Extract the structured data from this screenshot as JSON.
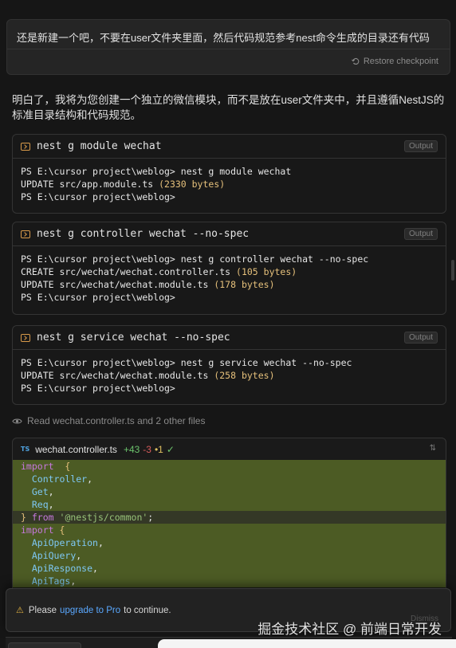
{
  "user_message": {
    "text": "还是新建一个吧，不要在user文件夹里面，然后代码规范参考nest命令生成的目录还有代码",
    "restore_label": "Restore checkpoint"
  },
  "assistant_text": "明白了，我将为您创建一个独立的微信模块，而不是放在user文件夹中，并且遵循NestJS的标准目录结构和代码规范。",
  "terminals": [
    {
      "command": "nest g module wechat",
      "badge": "Output",
      "lines": [
        [
          "PS E:\\cursor project\\weblog> nest g module wechat",
          "",
          ""
        ],
        [
          "UPDATE src/app.module.ts ",
          "(2330 bytes)",
          ""
        ],
        [
          "PS E:\\cursor project\\weblog>",
          "",
          ""
        ]
      ]
    },
    {
      "command": "nest g controller wechat --no-spec",
      "badge": "Output",
      "lines": [
        [
          "PS E:\\cursor project\\weblog> nest g controller wechat --no-spec",
          "",
          ""
        ],
        [
          "CREATE src/wechat/wechat.controller.ts ",
          "(105 bytes)",
          ""
        ],
        [
          "UPDATE src/wechat/wechat.module.ts ",
          "(178 bytes)",
          ""
        ],
        [
          "PS E:\\cursor project\\weblog>",
          "",
          ""
        ]
      ]
    },
    {
      "command": "nest g service wechat --no-spec",
      "badge": "Output",
      "lines": [
        [
          "PS E:\\cursor project\\weblog> nest g service wechat --no-spec",
          "",
          ""
        ],
        [
          "UPDATE src/wechat/wechat.module.ts ",
          "(258 bytes)",
          ""
        ],
        [
          "PS E:\\cursor project\\weblog>",
          "",
          ""
        ]
      ]
    }
  ],
  "read_line": "Read wechat.controller.ts and 2 other files",
  "code_file": {
    "lang_badge": "TS",
    "filename": "wechat.controller.ts",
    "added": "+43",
    "removed": "-3",
    "modified": "•1",
    "check": "✓",
    "lines": [
      {
        "dim": false,
        "parts": [
          [
            "kw",
            "import"
          ],
          [
            "",
            "  "
          ],
          [
            "brace",
            "{"
          ]
        ]
      },
      {
        "dim": false,
        "parts": [
          [
            "",
            "  "
          ],
          [
            "id",
            "Controller"
          ],
          [
            "",
            ","
          ]
        ]
      },
      {
        "dim": false,
        "parts": [
          [
            "",
            "  "
          ],
          [
            "id",
            "Get"
          ],
          [
            "",
            ","
          ]
        ]
      },
      {
        "dim": false,
        "parts": [
          [
            "",
            "  "
          ],
          [
            "id",
            "Req"
          ],
          [
            "",
            ","
          ]
        ]
      },
      {
        "dim": true,
        "parts": [
          [
            "brace",
            "}"
          ],
          [
            "",
            " "
          ],
          [
            "kw",
            "from"
          ],
          [
            "",
            " "
          ],
          [
            "str",
            "'@nestjs/common'"
          ],
          [
            "",
            ";"
          ]
        ]
      },
      {
        "dim": false,
        "parts": [
          [
            "kw",
            "import"
          ],
          [
            "",
            " "
          ],
          [
            "brace",
            "{"
          ]
        ]
      },
      {
        "dim": false,
        "parts": [
          [
            "",
            "  "
          ],
          [
            "id",
            "ApiOperation"
          ],
          [
            "",
            ","
          ]
        ]
      },
      {
        "dim": false,
        "parts": [
          [
            "",
            "  "
          ],
          [
            "id",
            "ApiQuery"
          ],
          [
            "",
            ","
          ]
        ]
      },
      {
        "dim": false,
        "parts": [
          [
            "",
            "  "
          ],
          [
            "id",
            "ApiResponse"
          ],
          [
            "",
            ","
          ]
        ]
      },
      {
        "dim": false,
        "parts": [
          [
            "",
            "  "
          ],
          [
            "id",
            "ApiTags"
          ],
          [
            "",
            ","
          ]
        ]
      }
    ]
  },
  "toast": {
    "icon": "warning-icon",
    "before": "Please",
    "link": "upgrade to Pro",
    "after": "to continue."
  },
  "watermark": "掘金技术社区 @ 前端日常开发",
  "faint_tag": "Dismiss"
}
